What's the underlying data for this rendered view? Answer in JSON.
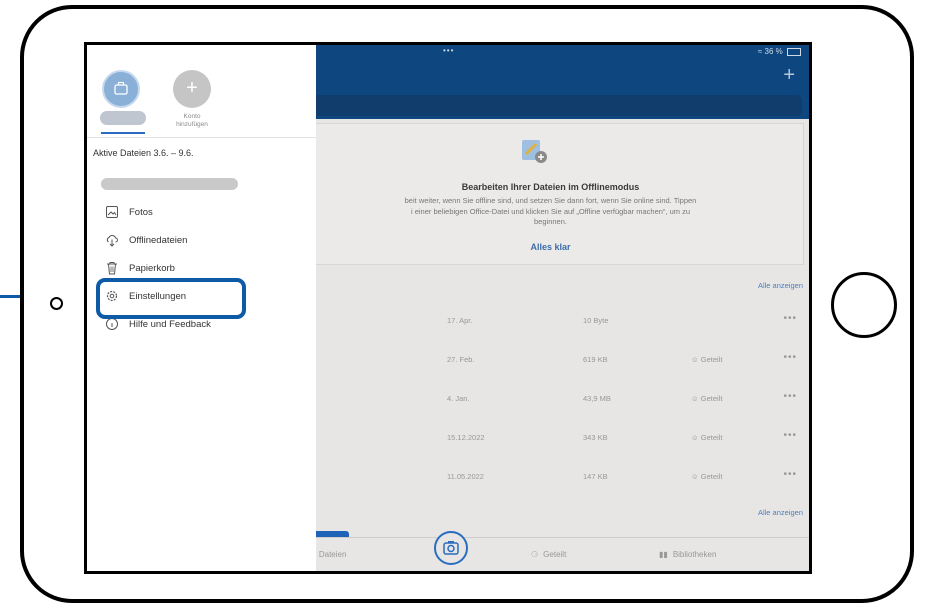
{
  "status": {
    "dots": "•••",
    "battery": "36 %"
  },
  "header": {
    "add_label": "+"
  },
  "offline_card": {
    "title": "Bearbeiten Ihrer Dateien im Offlinemodus",
    "body_line1": "beit weiter, wenn Sie offline sind, und setzen Sie dann fort, wenn Sie online sind. Tippen",
    "body_line2": "i einer beliebigen Office-Datei und klicken Sie auf „Offline verfügbar machen“, um zu",
    "body_line3": "beginnen.",
    "action": "Alles klar"
  },
  "see_all": "Alle anzeigen",
  "files": [
    {
      "date": "17. Apr.",
      "size": "10 Byte",
      "shared": ""
    },
    {
      "date": "27. Feb.",
      "size": "619 KB",
      "shared": "Geteilt"
    },
    {
      "date": "4. Jan.",
      "size": "43,9 MB",
      "shared": "Geteilt"
    },
    {
      "date": "15.12.2022",
      "size": "343 KB",
      "shared": "Geteilt"
    },
    {
      "date": "11.05.2022",
      "size": "147 KB",
      "shared": "Geteilt"
    }
  ],
  "more_label": "•••",
  "tabs": {
    "files": "Dateien",
    "shared": "Geteilt",
    "libraries": "Bibliotheken"
  },
  "drawer": {
    "add_account": "+",
    "add_account_label_1": "Konto",
    "add_account_label_2": "hinzufügen",
    "active_files": "Aktive Dateien 3.6. – 9.6.",
    "menu": {
      "fotos": "Fotos",
      "offline": "Offlinedateien",
      "trash": "Papierkorb",
      "settings": "Einstellungen",
      "help": "Hilfe und Feedback"
    }
  },
  "colors": {
    "accent": "#0d5aa7",
    "header": "#0e4780"
  }
}
